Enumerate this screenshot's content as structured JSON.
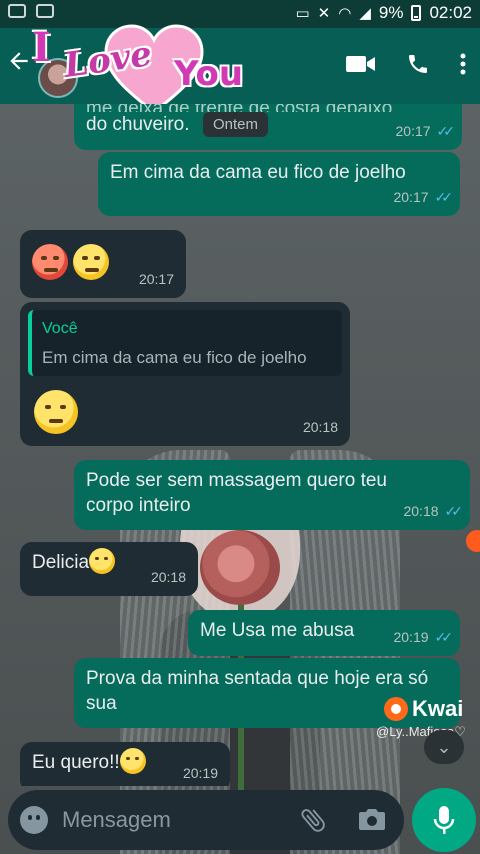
{
  "status_bar": {
    "battery": "9%",
    "time": "02:02"
  },
  "header": {
    "sticker_text_1": "I",
    "sticker_text_2": "Love",
    "sticker_text_3": "You"
  },
  "chat": {
    "date_chip": "Ontem",
    "messages": [
      {
        "dir": "out",
        "text": "do chuveiro.",
        "time": "20:17",
        "partial_top": "me deixa de frente de costa debaixo"
      },
      {
        "dir": "out",
        "text": "Em cima da cama eu fico de joelho",
        "time": "20:17"
      },
      {
        "dir": "in",
        "text": "",
        "time": "20:17",
        "emojis": [
          "hot-face-emoji",
          "smirk-emoji"
        ]
      },
      {
        "dir": "in",
        "quote_author": "Você",
        "quote_text": "Em cima da cama eu fico de joelho",
        "time": "20:18",
        "emojis": [
          "drooling-face-emoji"
        ]
      },
      {
        "dir": "out",
        "text": "Pode ser sem massagem quero teu corpo inteiro",
        "time": "20:18"
      },
      {
        "dir": "in",
        "text": "Delicia",
        "time": "20:18",
        "emojis": [
          "smirk-emoji"
        ]
      },
      {
        "dir": "out",
        "text": "Me Usa me abusa",
        "time": "20:19"
      },
      {
        "dir": "out",
        "text": "Prova da minha sentada que hoje era só sua",
        "time": ""
      },
      {
        "dir": "in",
        "text": "Eu quero!!",
        "time": "20:19",
        "emojis": [
          "drooling-face-emoji"
        ]
      }
    ]
  },
  "watermark": {
    "brand": "Kwai",
    "handle": "@Ly..Mafiosa♡"
  },
  "input": {
    "placeholder": "Mensagem"
  },
  "colors": {
    "header": "#075e54",
    "outgoing": "#056b5a",
    "incoming": "#1f2c34",
    "accent": "#00a884",
    "tick": "#53bdeb"
  }
}
